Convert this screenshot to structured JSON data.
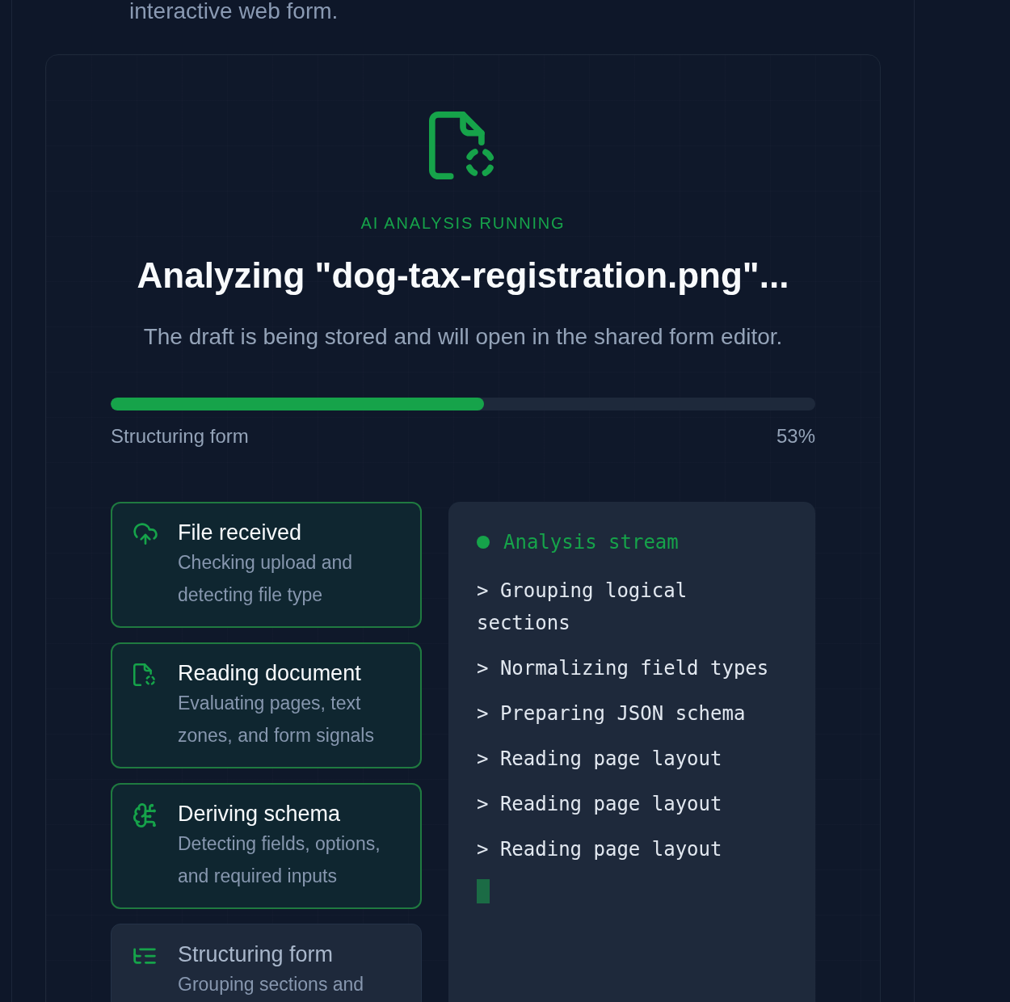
{
  "intro": {
    "text": "interactive web form."
  },
  "analysis": {
    "status": "AI ANALYSIS RUNNING",
    "title": "Analyzing \"dog-tax-registration.png\"...",
    "subtitle": "The draft is being stored and will open in the shared form editor."
  },
  "progress": {
    "level": 0.53,
    "label": "Structuring form",
    "percent": "53%"
  },
  "steps": [
    {
      "title": "File received",
      "description": "Checking upload and detecting file type",
      "done": true
    },
    {
      "title": "Reading document",
      "description": "Evaluating pages, text zones, and form signals",
      "done": true
    },
    {
      "title": "Deriving schema",
      "description": "Detecting fields, options, and required inputs",
      "done": true
    },
    {
      "title": "Structuring form",
      "description": "Grouping sections and",
      "done": false
    }
  ],
  "stream": {
    "title": "Analysis stream",
    "lines": [
      "> Grouping logical sections",
      "> Normalizing field types",
      "> Preparing JSON schema",
      "> Reading page layout",
      "> Reading page layout",
      "> Reading page layout"
    ]
  }
}
